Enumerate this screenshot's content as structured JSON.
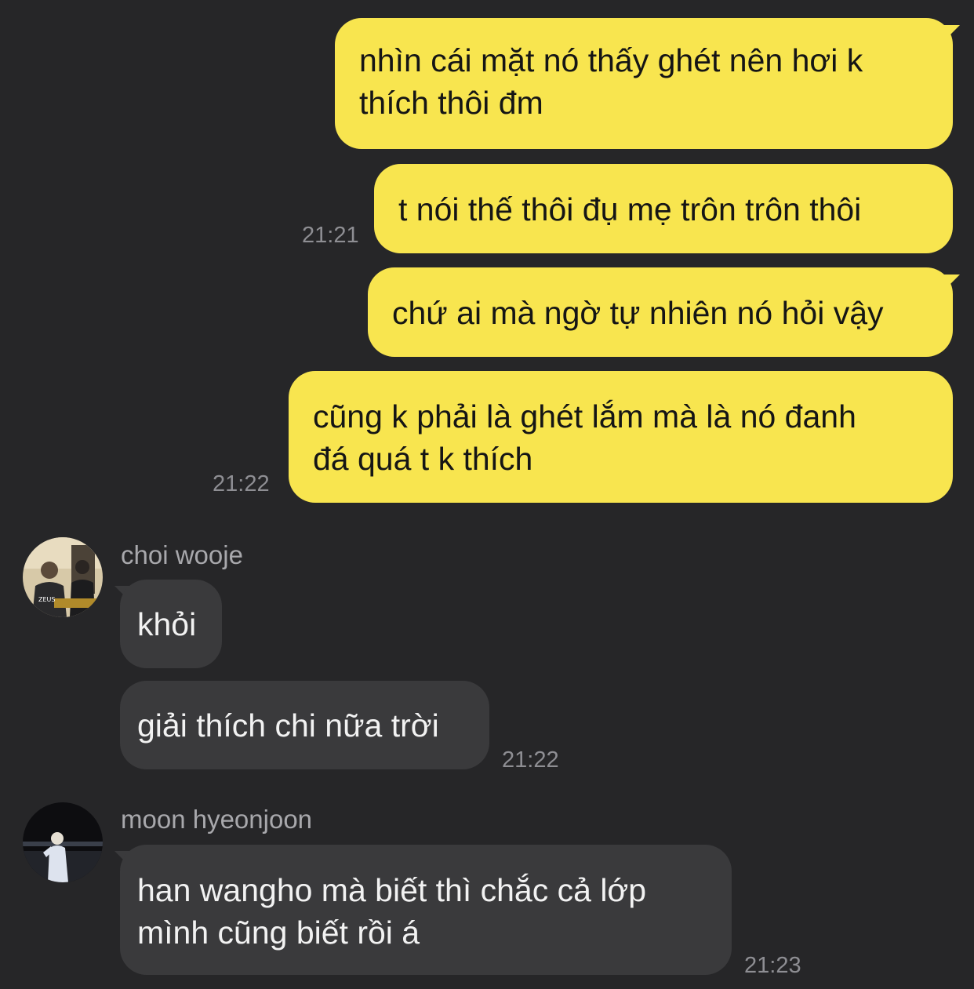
{
  "chat": {
    "outgoing": [
      {
        "text": "nhìn cái mặt nó thấy ghét nên hơi k\nthích thôi đm",
        "time": ""
      },
      {
        "text": "t nói thế thôi đụ mẹ trôn trôn thôi",
        "time": "21:21"
      },
      {
        "text": "chứ ai mà ngờ tự nhiên nó hỏi vậy",
        "time": ""
      },
      {
        "text": "cũng k phải là ghét lắm mà là nó đanh\nđá quá t k thích",
        "time": "21:22"
      }
    ],
    "groups": [
      {
        "sender": "choi wooje",
        "avatar_icon": "profile-photo-icon",
        "avatar_caption": "ZEUS",
        "messages": [
          {
            "text": "khỏi",
            "time": ""
          },
          {
            "text": "giải thích chi nữa trời",
            "time": "21:22"
          }
        ]
      },
      {
        "sender": "moon hyeonjoon",
        "avatar_icon": "profile-photo-icon",
        "messages": [
          {
            "text": "han wangho mà biết thì chắc cả lớp\nmình cũng biết rồi á",
            "time": "21:23"
          }
        ]
      }
    ]
  },
  "colors": {
    "background": "#262628",
    "outgoing_bubble": "#f8e54f",
    "incoming_bubble": "#3a3a3c",
    "timestamp": "#8e8e93",
    "sender_name": "#a8a8ac"
  }
}
